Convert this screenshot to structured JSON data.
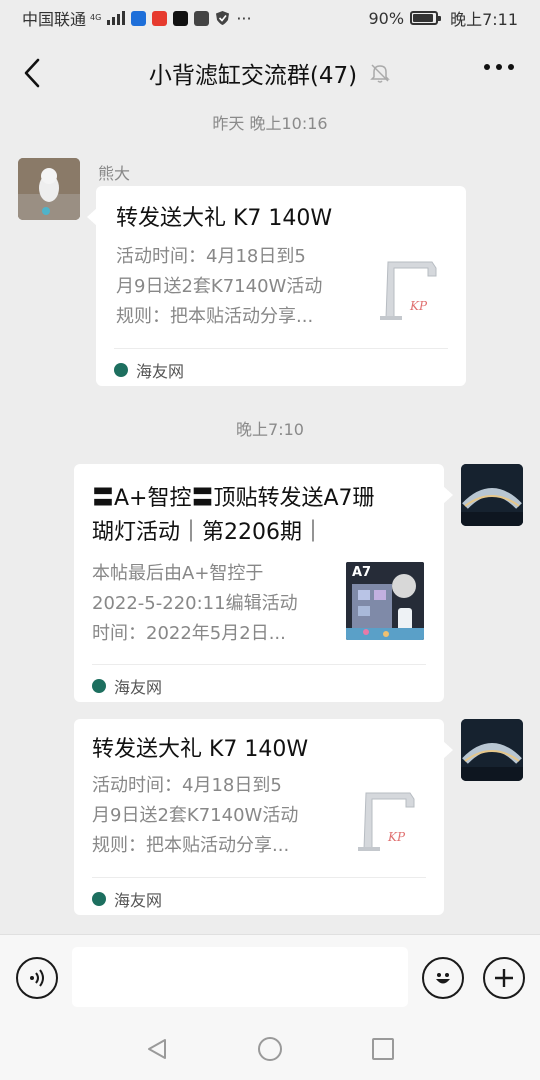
{
  "status_bar": {
    "carrier": "中国联通",
    "network": "4G",
    "battery": "90%",
    "battery_level": 0.9,
    "time": "晚上7:11"
  },
  "header": {
    "title": "小背滤缸交流群(47)",
    "back_icon": "chevron-left-icon",
    "mute_icon": "bell-off-icon",
    "more_icon": "more-dots-icon"
  },
  "messages": [
    {
      "timestamp": "昨天 晚上10:16",
      "sender": "熊大",
      "side": "left",
      "card": {
        "title": "转发送大礼 K7 140W",
        "desc_lines": [
          "活动时间：4月18日到5",
          "月9日送2套K7140W活动",
          "规则：把本贴活动分享..."
        ],
        "source": "海友网"
      }
    },
    {
      "timestamp": "晚上7:10",
      "side": "right",
      "card": {
        "title_lines": [
          "〓A+智控〓顶贴转发送A7珊",
          "瑚灯活动｜第2206期｜"
        ],
        "desc_lines": [
          "本帖最后由A+智控于",
          "2022-5-220:11编辑活动",
          "时间：2022年5月2日..."
        ],
        "thumb_text": "A7",
        "source": "海友网"
      }
    },
    {
      "side": "right",
      "card": {
        "title": "转发送大礼 K7 140W",
        "desc_lines": [
          "活动时间：4月18日到5",
          "月9日送2套K7140W活动",
          "规则：把本贴活动分享..."
        ],
        "source": "海友网"
      }
    }
  ],
  "input_bar": {
    "voice_icon": "voice-icon",
    "emoji_icon": "emoji-icon",
    "plus_icon": "plus-icon",
    "placeholder": ""
  },
  "nav_bar": {
    "back_icon": "nav-back-icon",
    "home_icon": "nav-home-icon",
    "recents_icon": "nav-recents-icon"
  },
  "colors": {
    "background": "#ededed",
    "bubble": "#ffffff",
    "source_icon": "#1d6f5f"
  }
}
